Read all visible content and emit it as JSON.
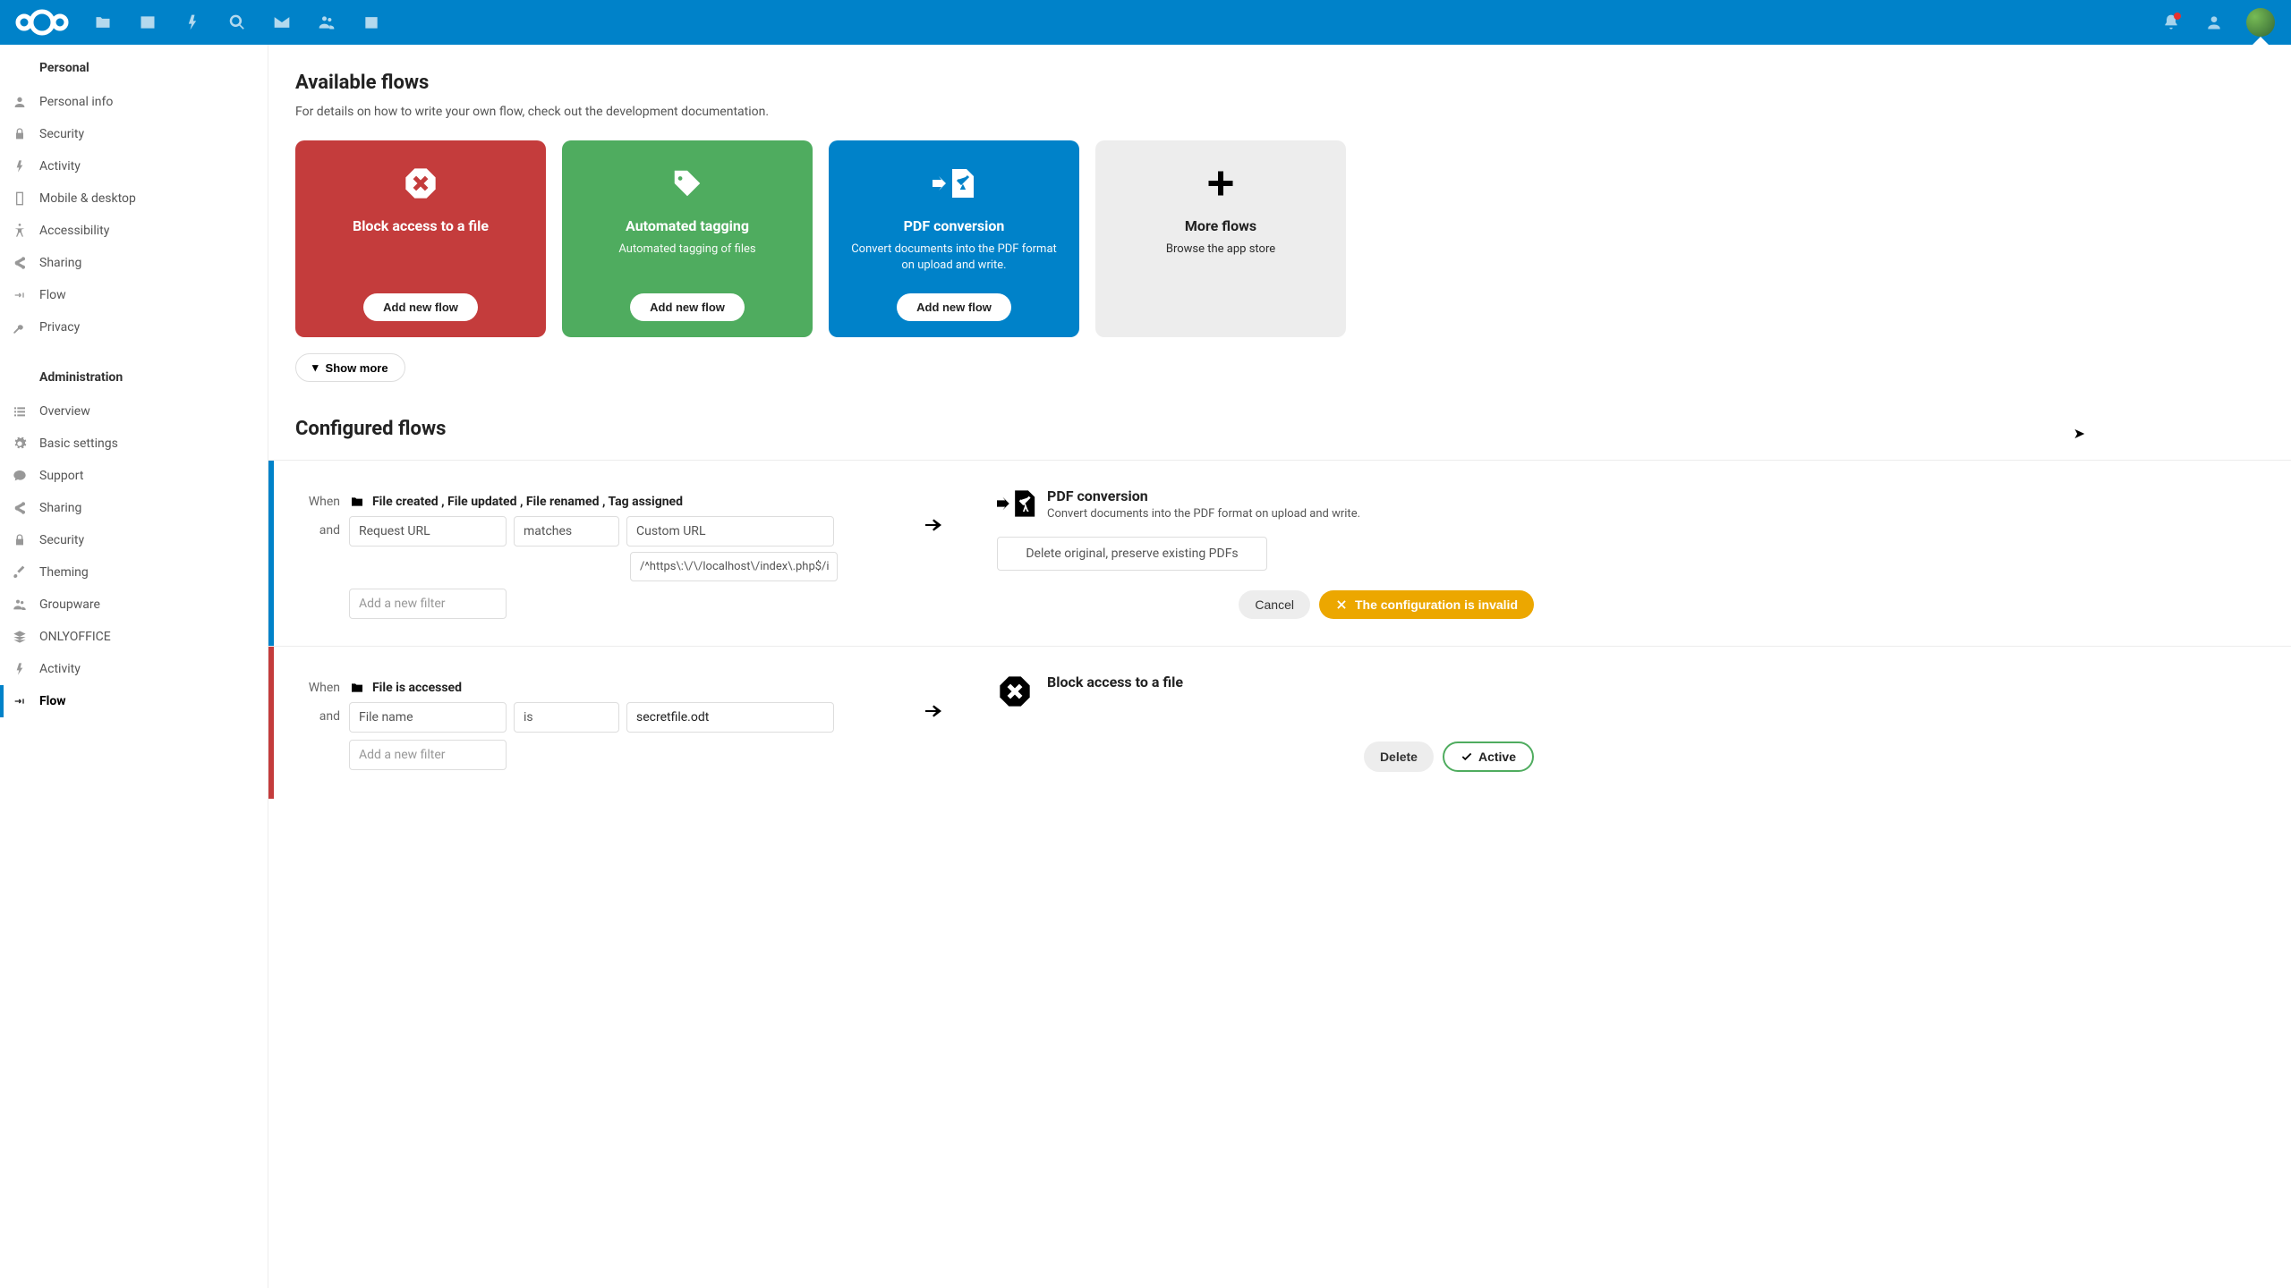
{
  "sidebar": {
    "personal": {
      "title": "Personal",
      "items": [
        {
          "label": "Personal info"
        },
        {
          "label": "Security"
        },
        {
          "label": "Activity"
        },
        {
          "label": "Mobile & desktop"
        },
        {
          "label": "Accessibility"
        },
        {
          "label": "Sharing"
        },
        {
          "label": "Flow"
        },
        {
          "label": "Privacy"
        }
      ]
    },
    "admin": {
      "title": "Administration",
      "items": [
        {
          "label": "Overview"
        },
        {
          "label": "Basic settings"
        },
        {
          "label": "Support"
        },
        {
          "label": "Sharing"
        },
        {
          "label": "Security"
        },
        {
          "label": "Theming"
        },
        {
          "label": "Groupware"
        },
        {
          "label": "ONLYOFFICE"
        },
        {
          "label": "Activity"
        },
        {
          "label": "Flow"
        }
      ]
    }
  },
  "available": {
    "title": "Available flows",
    "subtitle": "For details on how to write your own flow, check out the development documentation.",
    "cards": [
      {
        "title": "Block access to a file",
        "desc": "",
        "btn": "Add new flow"
      },
      {
        "title": "Automated tagging",
        "desc": "Automated tagging of files",
        "btn": "Add new flow"
      },
      {
        "title": "PDF conversion",
        "desc": "Convert documents into the PDF format on upload and write.",
        "btn": "Add new flow"
      },
      {
        "title": "More flows",
        "desc": "Browse the app store"
      }
    ],
    "show_more": "Show more"
  },
  "configured": {
    "title": "Configured flows",
    "rules": [
      {
        "when_label": "When",
        "and_label": "and",
        "events": "File created ,   File updated ,   File renamed ,   Tag assigned",
        "filter_field": "Request URL",
        "filter_op": "matches",
        "filter_val1": "Custom URL",
        "filter_val2": "/^https\\:\\/\\/localhost\\/index\\.php$/i",
        "add_filter": "Add a new filter",
        "result_title": "PDF conversion",
        "result_desc": "Convert documents into the PDF format on upload and write.",
        "option": "Delete original, preserve existing PDFs",
        "cancel": "Cancel",
        "invalid": "The configuration is invalid"
      },
      {
        "when_label": "When",
        "and_label": "and",
        "events": "File is accessed",
        "filter_field": "File name",
        "filter_op": "is",
        "filter_val1": "secretfile.odt",
        "add_filter": "Add a new filter",
        "result_title": "Block access to a file",
        "delete": "Delete",
        "active": "Active"
      }
    ]
  }
}
